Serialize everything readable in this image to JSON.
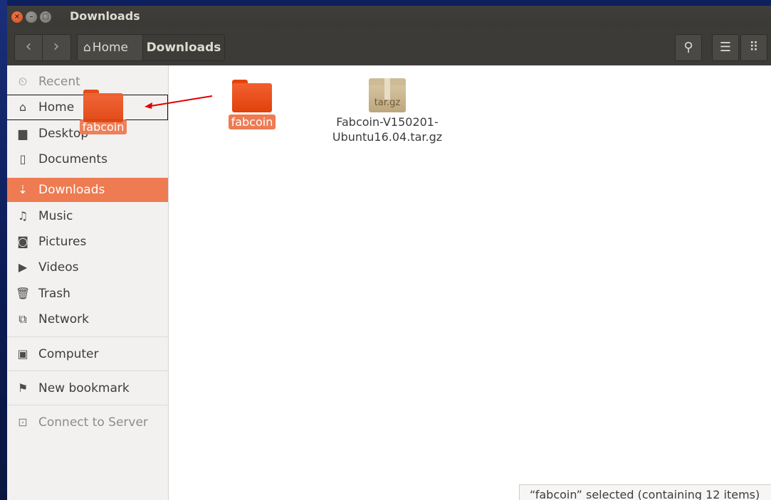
{
  "window": {
    "title": "Downloads"
  },
  "titlebar": {
    "close_glyph": "×",
    "min_glyph": "–",
    "max_glyph": "□"
  },
  "toolbar": {
    "back_icon": "‹",
    "forward_icon": "›",
    "breadcrumb": {
      "home_icon": "⌂",
      "home_label": "Home",
      "current_label": "Downloads"
    },
    "search_icon": "⚲",
    "list_icon": "☰",
    "grid_icon": "⠿"
  },
  "sidebar": {
    "items": [
      {
        "label": "Recent",
        "icon": "clock-icon",
        "glyph": "⏲",
        "state": "dim"
      },
      {
        "label": "Home",
        "icon": "home-icon",
        "glyph": "⌂",
        "state": "drop-target"
      },
      {
        "label": "Desktop",
        "icon": "desktop-icon",
        "glyph": "▆",
        "state": "normal"
      },
      {
        "label": "Documents",
        "icon": "document-icon",
        "glyph": "▯",
        "state": "normal"
      },
      {
        "label": "Downloads",
        "icon": "download-icon",
        "glyph": "⇣",
        "state": "active"
      },
      {
        "label": "Music",
        "icon": "music-icon",
        "glyph": "♫",
        "state": "normal"
      },
      {
        "label": "Pictures",
        "icon": "camera-icon",
        "glyph": "◙",
        "state": "normal"
      },
      {
        "label": "Videos",
        "icon": "video-icon",
        "glyph": "▶",
        "state": "normal"
      },
      {
        "label": "Trash",
        "icon": "trash-icon",
        "glyph": "🗑",
        "state": "normal"
      },
      {
        "label": "Network",
        "icon": "network-icon",
        "glyph": "⧉",
        "state": "normal"
      },
      {
        "label": "Computer",
        "icon": "computer-icon",
        "glyph": "▣",
        "state": "normal"
      },
      {
        "label": "New bookmark",
        "icon": "bookmark-icon",
        "glyph": "⚑",
        "state": "normal"
      },
      {
        "label": "Connect to Server",
        "icon": "server-icon",
        "glyph": "⊡",
        "state": "dim"
      }
    ]
  },
  "files": [
    {
      "name": "fabcoin",
      "type": "folder",
      "selected": true
    },
    {
      "name_line1": "Fabcoin-V150201-",
      "name_line2": "Ubuntu16.04.tar.gz",
      "type": "archive",
      "badge": "tar.gz"
    }
  ],
  "drag": {
    "label": "fabcoin"
  },
  "status": {
    "text": "“fabcoin” selected  (containing 12 items)"
  },
  "colors": {
    "accent": "#ee7b52",
    "folder": "#e8491c",
    "toolbar": "#3c3b37",
    "arrow": "#e00000"
  }
}
